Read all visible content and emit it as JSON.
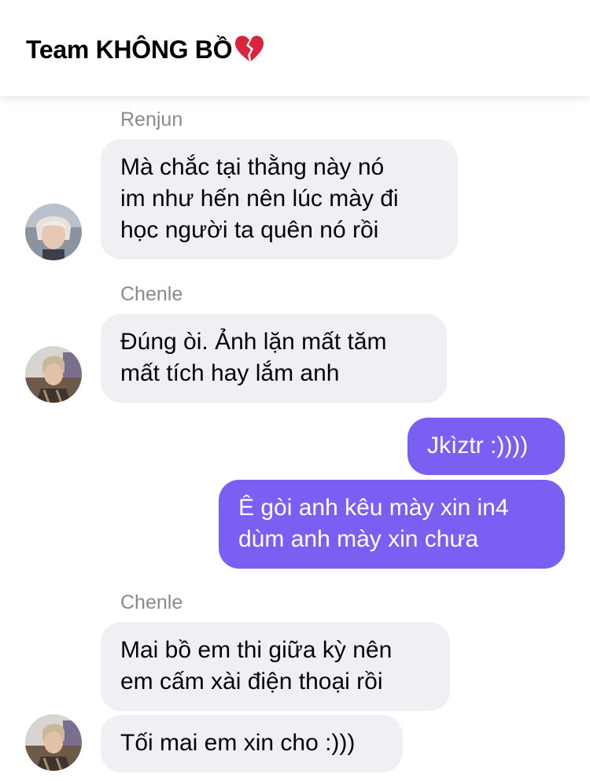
{
  "header": {
    "title": "Team KHÔNG BỒ",
    "title_icon": "broken-heart-icon"
  },
  "messages": [
    {
      "sender": "Renjun",
      "direction": "incoming",
      "text": "Mà chắc tại thằng này nó\nim như hến nên lúc mày đi\nhọc người ta quên nó rồi"
    },
    {
      "sender": "Chenle",
      "direction": "incoming",
      "text": "Đúng òi. Ảnh lặn mất tăm\nmất tích hay lắm anh"
    },
    {
      "direction": "outgoing",
      "text": "Jkìztr :))))"
    },
    {
      "direction": "outgoing",
      "text": "Ê gòi anh kêu mày xin in4\ndùm anh mày xin chưa"
    },
    {
      "sender": "Chenle",
      "direction": "incoming",
      "text": "Mai bồ em thi giữa kỳ nên\nem cấm xài điện thoại rồi"
    },
    {
      "direction": "incoming",
      "text": "Tối mai em xin cho :)))"
    }
  ],
  "colors": {
    "outgoing_bubble": "#7b5ff2",
    "incoming_bubble": "#efeff4",
    "sender_name": "#8a8a8e",
    "heart": "#d9243c"
  }
}
